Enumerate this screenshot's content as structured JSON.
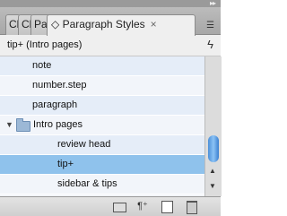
{
  "tabs": [
    {
      "label": "Cl"
    },
    {
      "label": "Cl"
    },
    {
      "label": "Pa"
    },
    {
      "label": "◇ Paragraph Styles",
      "close": "×"
    }
  ],
  "header": {
    "current_style": "tip+ (Intro pages)"
  },
  "styles": [
    {
      "label": "note"
    },
    {
      "label": "number.step"
    },
    {
      "label": "paragraph"
    },
    {
      "label": "Intro pages"
    },
    {
      "label": "review head"
    },
    {
      "label": "tip+"
    },
    {
      "label": "sidebar & tips"
    }
  ],
  "icons": {
    "collapse": "double-chevron-icon",
    "panel_menu": "panel-menu-icon",
    "lightning": "lightning-icon",
    "folder": "folder-icon",
    "disclosure": "disclosure-triangle-icon"
  },
  "colors": {
    "selected_row": "#8fc2ec",
    "alt_row": "#e5edf8",
    "scroll_thumb": "#4c8fd8"
  }
}
